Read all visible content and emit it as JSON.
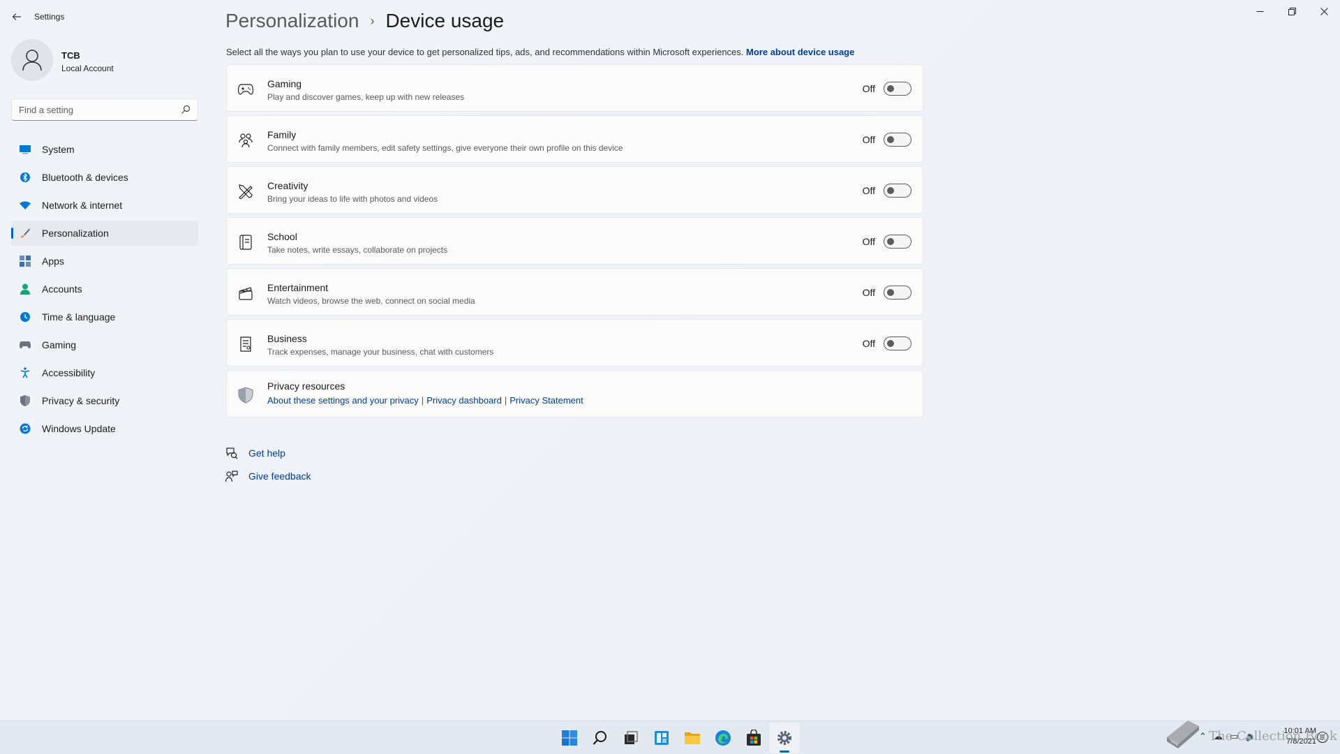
{
  "window": {
    "app_title": "Settings",
    "controls": [
      "minimize",
      "restore",
      "close"
    ]
  },
  "profile": {
    "name": "TCB",
    "account_type": "Local Account"
  },
  "search": {
    "placeholder": "Find a setting"
  },
  "nav": {
    "items": [
      {
        "label": "System",
        "icon": "monitor-icon",
        "color": "#0078d4"
      },
      {
        "label": "Bluetooth & devices",
        "icon": "bluetooth-icon",
        "color": "#0078d4"
      },
      {
        "label": "Network & internet",
        "icon": "wifi-icon",
        "color": "#0078d4"
      },
      {
        "label": "Personalization",
        "icon": "brush-icon",
        "color": "#e8883a",
        "selected": true
      },
      {
        "label": "Apps",
        "icon": "apps-icon",
        "color": "#3e6fb0"
      },
      {
        "label": "Accounts",
        "icon": "person-icon",
        "color": "#1aa37a"
      },
      {
        "label": "Time & language",
        "icon": "globe-clock-icon",
        "color": "#0078d4"
      },
      {
        "label": "Gaming",
        "icon": "controller-icon",
        "color": "#6b7280"
      },
      {
        "label": "Accessibility",
        "icon": "accessibility-icon",
        "color": "#0078d4"
      },
      {
        "label": "Privacy & security",
        "icon": "shield-icon",
        "color": "#6b7280"
      },
      {
        "label": "Windows Update",
        "icon": "update-icon",
        "color": "#0078d4"
      }
    ]
  },
  "breadcrumb": {
    "parent": "Personalization",
    "separator": "›",
    "current": "Device usage"
  },
  "intro": {
    "text": "Select all the ways you plan to use your device to get personalized tips, ads, and recommendations within Microsoft experiences.",
    "link": "More about device usage"
  },
  "options": [
    {
      "title": "Gaming",
      "description": "Play and discover games, keep up with new releases",
      "state": "Off",
      "on": false,
      "icon": "gamepad-icon"
    },
    {
      "title": "Family",
      "description": "Connect with family members, edit safety settings, give everyone their own profile on this device",
      "state": "Off",
      "on": false,
      "icon": "family-icon"
    },
    {
      "title": "Creativity",
      "description": "Bring your ideas to life with photos and videos",
      "state": "Off",
      "on": false,
      "icon": "pen-ruler-icon"
    },
    {
      "title": "School",
      "description": "Take notes, write essays, collaborate on projects",
      "state": "Off",
      "on": false,
      "icon": "notebook-icon"
    },
    {
      "title": "Entertainment",
      "description": "Watch videos, browse the web, connect on social media",
      "state": "Off",
      "on": false,
      "icon": "clapperboard-icon"
    },
    {
      "title": "Business",
      "description": "Track expenses, manage your business, chat with customers",
      "state": "Off",
      "on": false,
      "icon": "receipt-icon"
    }
  ],
  "privacy": {
    "title": "Privacy resources",
    "links": [
      "About these settings and your privacy",
      "Privacy dashboard",
      "Privacy Statement"
    ],
    "separator": "|"
  },
  "help": {
    "get_help": "Get help",
    "give_feedback": "Give feedback"
  },
  "taskbar": {
    "apps": [
      "start-icon",
      "search-icon",
      "task-view-icon",
      "widgets-icon",
      "file-explorer-icon",
      "edge-icon",
      "store-icon",
      "settings-icon"
    ],
    "active_app": "settings-icon",
    "time": "10:01 AM",
    "date": "7/8/2021"
  },
  "watermark": {
    "text": "The Collection Book"
  },
  "colors": {
    "accent": "#0067c0",
    "link": "#003e92",
    "background": "#eef1f6",
    "card": "#fbfbfc"
  }
}
